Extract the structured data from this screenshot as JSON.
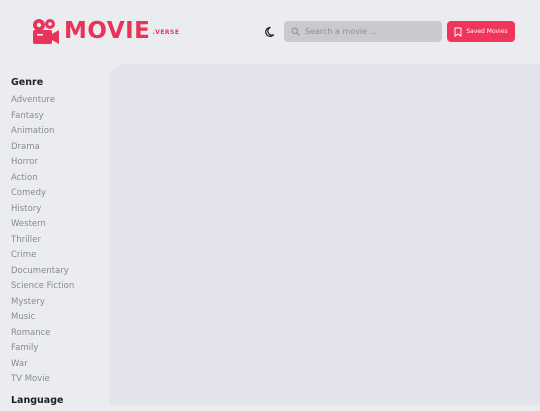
{
  "brand": {
    "name": "MOVIE",
    "suffix": ".VERSE"
  },
  "header": {
    "search": {
      "placeholder": "Search a movie ..."
    },
    "saved_label": "Saved Movies"
  },
  "sidebar": {
    "genre_heading": "Genre",
    "genres": [
      "Adventure",
      "Fantasy",
      "Animation",
      "Drama",
      "Horror",
      "Action",
      "Comedy",
      "History",
      "Western",
      "Thriller",
      "Crime",
      "Documentary",
      "Science Fiction",
      "Mystery",
      "Music",
      "Romance",
      "Family",
      "War",
      "TV Movie"
    ],
    "language_heading": "Language"
  },
  "colors": {
    "accent": "#f0345a",
    "background": "#ebecf0",
    "panel": "#e3e3eb"
  },
  "icons": {
    "logo": "film-camera-icon",
    "theme": "moon-icon",
    "search": "search-icon",
    "saved": "bookmark-icon"
  }
}
